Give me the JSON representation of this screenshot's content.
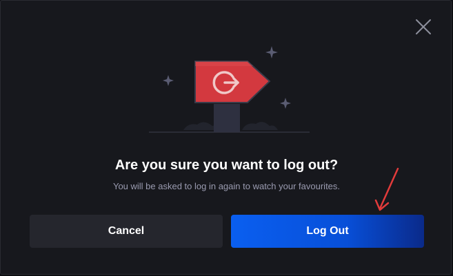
{
  "dialog": {
    "title": "Are you sure you want to log out?",
    "subtitle": "You will be asked to log in again to watch your favourites.",
    "cancel_label": "Cancel",
    "logout_label": "Log Out"
  },
  "icons": {
    "close": "close-icon",
    "logout": "logout-icon",
    "illustration": "signpost-illustration",
    "annotation": "red-arrow-annotation"
  },
  "colors": {
    "background": "#17181d",
    "cancel_button": "#25262d",
    "logout_button": "#0a5ff0",
    "sign": "#d3393f",
    "annotation_arrow": "#e23b3b"
  }
}
